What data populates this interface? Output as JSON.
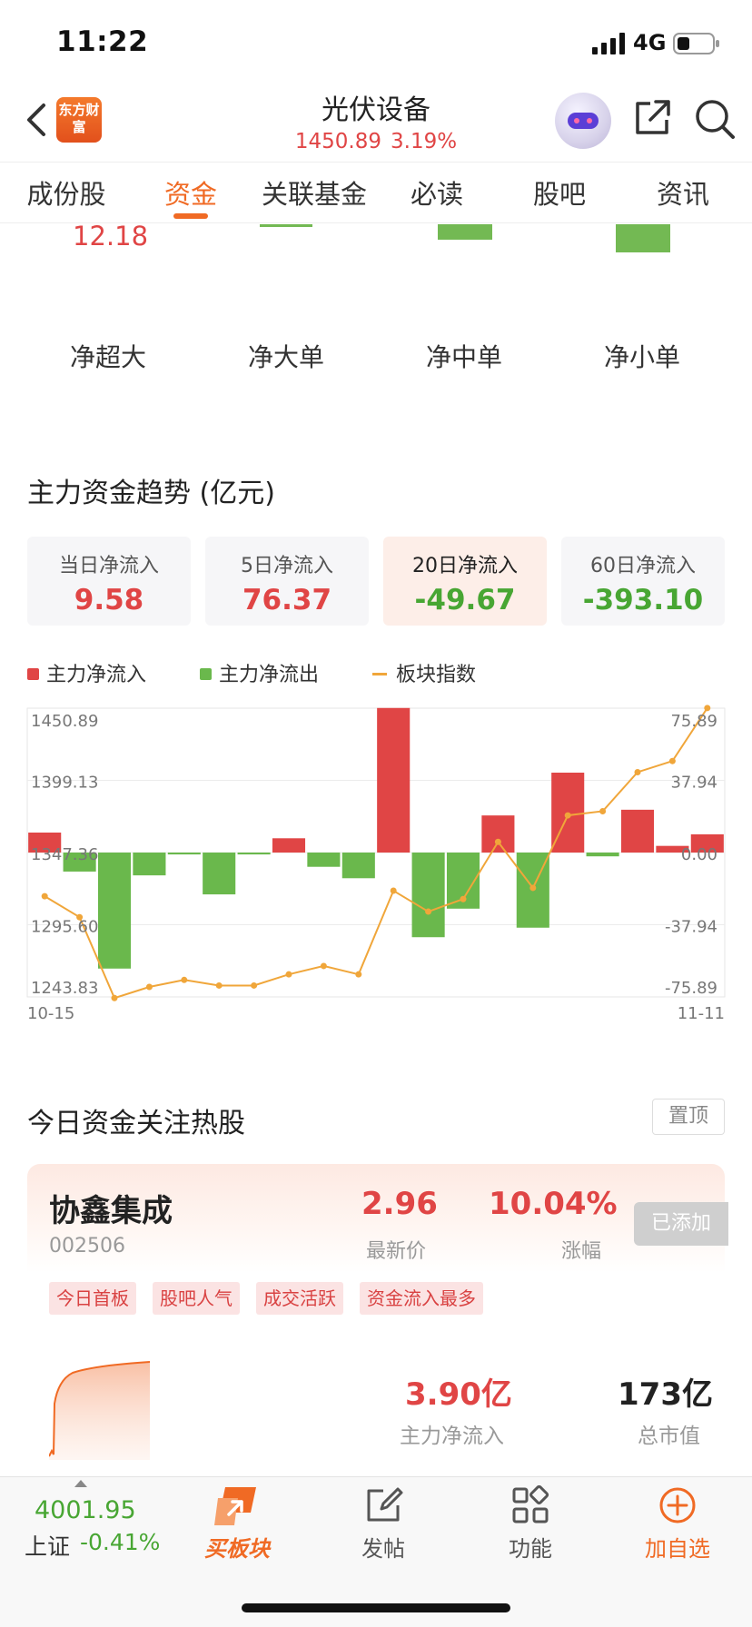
{
  "status_bar": {
    "time": "11:22",
    "network": "4G"
  },
  "header": {
    "logo_text": "东方财富",
    "title": "光伏设备",
    "price": "1450.89",
    "change": "3.19%"
  },
  "tabs": [
    {
      "label": "成份股",
      "active": false
    },
    {
      "label": "资金",
      "active": true
    },
    {
      "label": "关联基金",
      "active": false
    },
    {
      "label": "必读",
      "active": false
    },
    {
      "label": "股吧",
      "active": false
    },
    {
      "label": "资讯",
      "active": false
    }
  ],
  "flow_partial": {
    "first_value": "12.18",
    "labels": [
      "净超大",
      "净大单",
      "净中单",
      "净小单"
    ]
  },
  "trend": {
    "title": "主力资金趋势 (亿元)",
    "stats": [
      {
        "label": "当日净流入",
        "value": "9.58",
        "color": "red",
        "selected": false
      },
      {
        "label": "5日净流入",
        "value": "76.37",
        "color": "red",
        "selected": false
      },
      {
        "label": "20日净流入",
        "value": "-49.67",
        "color": "green",
        "selected": true
      },
      {
        "label": "60日净流入",
        "value": "-393.10",
        "color": "green",
        "selected": false
      }
    ],
    "legend": {
      "inflow": "主力净流入",
      "outflow": "主力净流出",
      "index": "板块指数"
    }
  },
  "chart_data": {
    "type": "bar",
    "x_start_label": "10-15",
    "x_end_label": "11-11",
    "left_axis_ticks": [
      "1450.89",
      "1399.13",
      "1347.36",
      "1295.60",
      "1243.83"
    ],
    "right_axis_ticks": [
      "75.89",
      "37.94",
      "0.00",
      "-37.94",
      "-75.89"
    ],
    "flow_ylim": [
      -75.89,
      75.89
    ],
    "index_ylim": [
      1243.83,
      1450.89
    ],
    "series": [
      {
        "name": "主力净流入",
        "values": [
          10.5,
          -10.0,
          -61.0,
          -12.0,
          -1.0,
          -22.0,
          -1.0,
          7.5,
          -7.5,
          -13.5,
          76.0,
          -44.5,
          -29.5,
          19.5,
          -39.5,
          42.0,
          -2.0,
          22.5,
          3.5,
          9.58
        ]
      },
      {
        "name": "板块指数",
        "values": [
          1316,
          1301,
          1243,
          1251,
          1256,
          1252,
          1252,
          1260,
          1266,
          1260,
          1320,
          1305,
          1314,
          1355,
          1322,
          1374,
          1377,
          1405,
          1413,
          1451
        ]
      }
    ],
    "colors": {
      "inflow": "#e04545",
      "outflow": "#6ab84c",
      "index": "#f0a63a"
    }
  },
  "hot_stocks": {
    "title": "今日资金关注热股",
    "pin_label": "置顶",
    "card": {
      "name": "协鑫集成",
      "code": "002506",
      "price": "2.96",
      "price_label": "最新价",
      "change": "10.04%",
      "change_label": "涨幅",
      "added_label": "已添加",
      "tags": [
        "今日首板",
        "股吧人气",
        "成交活跃",
        "资金流入最多"
      ],
      "main_inflow": "3.90亿",
      "main_inflow_label": "主力净流入",
      "market_cap": "173亿",
      "market_cap_label": "总市值"
    }
  },
  "bottom_bar": {
    "index_value": "4001.95",
    "index_name": "上证",
    "index_change": "-0.41%",
    "items": [
      {
        "label": "买板块",
        "icon": "buy-sector-icon"
      },
      {
        "label": "发帖",
        "icon": "compose-icon"
      },
      {
        "label": "功能",
        "icon": "grid-icon"
      },
      {
        "label": "加自选",
        "icon": "add-circle-icon"
      }
    ]
  }
}
